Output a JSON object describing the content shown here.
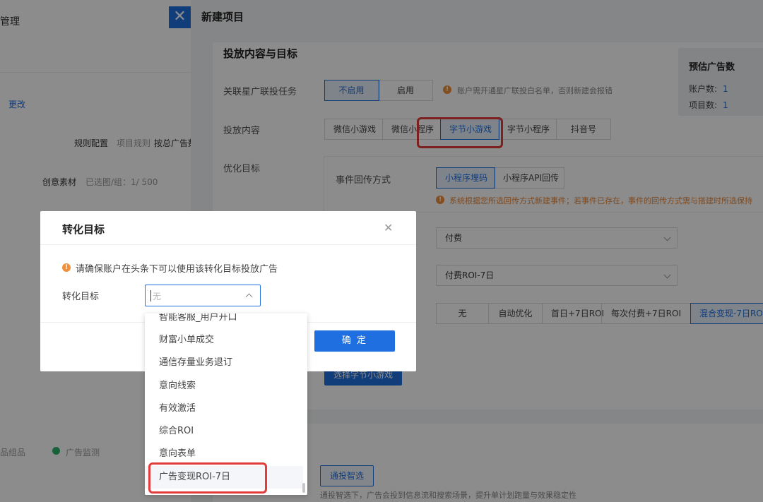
{
  "background": {
    "title": "管理",
    "change_link": "更改",
    "rule_label": "规则配置",
    "rule_sub": "项目规则",
    "rule_value": "按总广告数",
    "creative_label": "创意素材",
    "creative_sub": "已选图/组：1/ 500",
    "bottom_left": "品组品",
    "bottom_status": "广告监测"
  },
  "drawer": {
    "title": "新建项目",
    "section_title": "投放内容与目标",
    "linked_task": {
      "label": "关联星广联投任务",
      "options": [
        "不启用",
        "启用"
      ],
      "note": "账户需开通星广联投白名单，否则新建会报错"
    },
    "content": {
      "label": "投放内容",
      "options": [
        "微信小游戏",
        "微信小程序",
        "字节小游戏",
        "字节小程序",
        "抖音号"
      ]
    },
    "optimize": {
      "label": "优化目标",
      "event_label": "事件回传方式",
      "event_options": [
        "小程序埋码",
        "小程序API回传"
      ],
      "event_note": "系统根据您所选回传方式新建事件；若事件已存在，事件的回传方式需与搭建时所选保持"
    },
    "select1_value": "付费",
    "select2_value": "付费ROI-7日",
    "bid_options": [
      "无",
      "自动优化",
      "首日+7日ROI",
      "每次付费+7日ROI",
      "混合变现-7日ROI"
    ],
    "pick_button": "选择字节小游戏",
    "smart_button": "通投智选",
    "smart_note": "通投智选下，广告会投到信息流和搜索场景，提升单计划跑量与效果稳定性",
    "estimate": {
      "title": "预估广告数",
      "account_label": "账户数:",
      "account_value": "1",
      "project_label": "项目数:",
      "project_value": "1"
    }
  },
  "modal": {
    "title": "转化目标",
    "warning": "请确保账户在头条下可以使用该转化目标投放广告",
    "field_label": "转化目标",
    "placeholder": "无",
    "ok_button": "确 定"
  },
  "dropdown": {
    "items": [
      "智能客服_用户开口",
      "财富小单成交",
      "通信存量业务退订",
      "意向线索",
      "有效激活",
      "综合ROI",
      "意向表单",
      "广告变现ROI-7日"
    ]
  },
  "colors": {
    "accent": "#1f6fe0",
    "highlight": "#e23b3b",
    "warning": "#f0903b"
  }
}
